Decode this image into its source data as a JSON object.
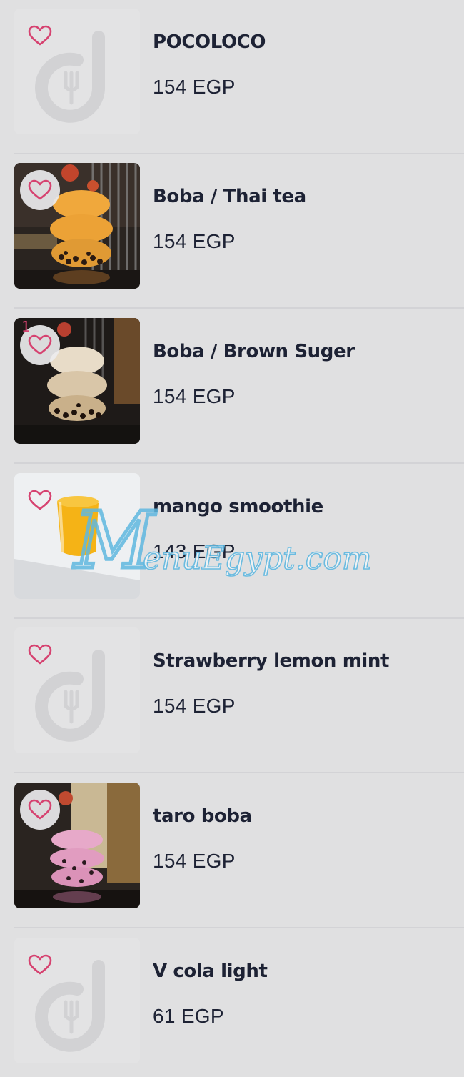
{
  "items": [
    {
      "name": "POCOLOCO",
      "price": "154 EGP"
    },
    {
      "name": "Boba / Thai tea",
      "price": "154 EGP"
    },
    {
      "name": "Boba / Brown Suger",
      "price": "154 EGP",
      "badge": "1"
    },
    {
      "name": "mango smoothie",
      "price": "143 EGP"
    },
    {
      "name": "Strawberry lemon mint",
      "price": "154 EGP"
    },
    {
      "name": "taro boba",
      "price": "154 EGP"
    },
    {
      "name": "V cola light",
      "price": "61 EGP"
    }
  ],
  "watermark": {
    "text": "MenuEgypt.com"
  },
  "colors": {
    "accent": "#d64270",
    "text": "#1d2234",
    "background": "#e0e0e1"
  },
  "icons": {
    "favorite": "heart-outline-icon",
    "placeholder": "restaurant-logo-icon"
  }
}
